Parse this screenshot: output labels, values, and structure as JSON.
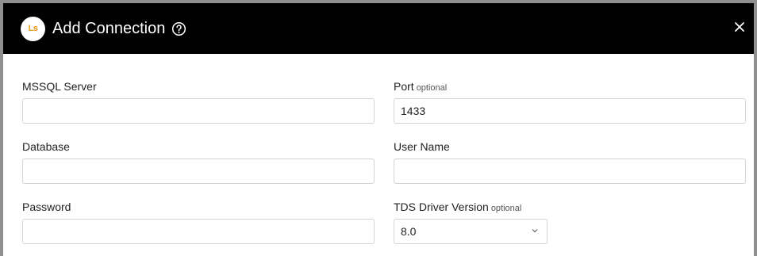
{
  "dialog": {
    "logo_text": "Ls",
    "title": "Add Connection",
    "help_icon": "help-circle-icon",
    "close_icon": "close-icon"
  },
  "fields": {
    "server": {
      "label": "MSSQL Server",
      "value": ""
    },
    "port": {
      "label": "Port",
      "optional": "optional",
      "value": "1433"
    },
    "database": {
      "label": "Database",
      "value": ""
    },
    "username": {
      "label": "User Name",
      "value": ""
    },
    "password": {
      "label": "Password",
      "value": ""
    },
    "tds": {
      "label": "TDS Driver Version",
      "optional": "optional",
      "selected": "8.0"
    }
  },
  "colors": {
    "header_bg": "#000000",
    "frame": "#8f8f8f",
    "input_border": "#d4d4d4",
    "logo_accent": "#f0a020"
  }
}
